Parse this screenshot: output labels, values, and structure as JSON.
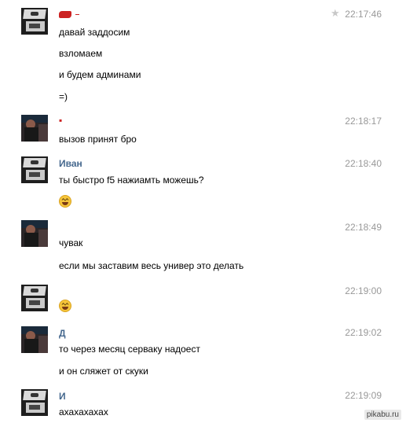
{
  "messages": [
    {
      "sender": "",
      "time": "22:17:46",
      "starred": true,
      "lines": [
        "давай заддосим",
        "взломаем",
        "и будем админами",
        "=)"
      ]
    },
    {
      "sender": "",
      "time": "22:18:17",
      "lines": [
        "вызов принят бро"
      ]
    },
    {
      "sender": "Иван",
      "time": "22:18:40",
      "lines": [
        "ты быстро f5 нажиамть можешь?"
      ],
      "emoji": "laughing-emoji"
    },
    {
      "sender": "",
      "time": "22:18:49",
      "lines": [
        "чувак",
        "если мы заставим весь универ это делать"
      ]
    },
    {
      "sender": "",
      "time": "22:19:00",
      "lines": [],
      "emoji": "laughing-emoji"
    },
    {
      "sender": "Д",
      "time": "22:19:02",
      "lines": [
        "то через месяц серваку надоест",
        "и он сляжет от скуки"
      ]
    },
    {
      "sender": "И",
      "time": "22:19:09",
      "lines": [
        "ахахахахах"
      ]
    }
  ],
  "watermark": "pikabu.ru",
  "colors": {
    "name": "#45688e",
    "time": "#999999",
    "star": "#c8c8c8"
  }
}
